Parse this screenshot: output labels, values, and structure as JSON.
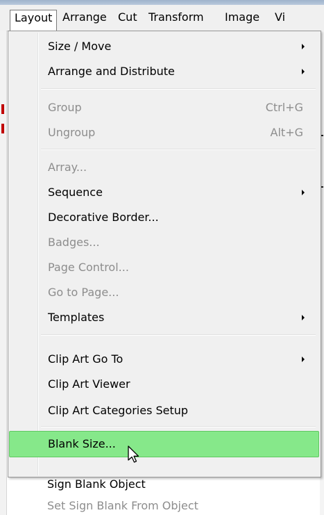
{
  "menubar": {
    "items": [
      {
        "label": "Layout"
      },
      {
        "label": "Arrange"
      },
      {
        "label": "Cut"
      },
      {
        "label": "Transform"
      },
      {
        "label": "Image"
      },
      {
        "label": "Vi"
      }
    ]
  },
  "menu": {
    "items": [
      {
        "label": "Size / Move"
      },
      {
        "label": "Arrange and Distribute"
      },
      {
        "label": "Group",
        "shortcut": "Ctrl+G"
      },
      {
        "label": "Ungroup",
        "shortcut": "Alt+G"
      },
      {
        "label": "Array..."
      },
      {
        "label": "Sequence"
      },
      {
        "label": "Decorative Border..."
      },
      {
        "label": "Badges..."
      },
      {
        "label": "Page Control..."
      },
      {
        "label": "Go to Page..."
      },
      {
        "label": "Templates"
      },
      {
        "label": "Clip Art Go To"
      },
      {
        "label": "Clip Art Viewer"
      },
      {
        "label": "Clip Art Categories Setup"
      },
      {
        "label": "Blank Size..."
      },
      {
        "label": "Sign Blank Object"
      },
      {
        "label": "Set Sign Blank From Object"
      }
    ]
  },
  "colors": {
    "highlight": "#86e88a",
    "menu_background": "#f0f0f0",
    "disabled_text": "#8d8d8d"
  },
  "icons": {
    "submenu": "chevron-right-icon",
    "cursor": "mouse-pointer-icon"
  }
}
